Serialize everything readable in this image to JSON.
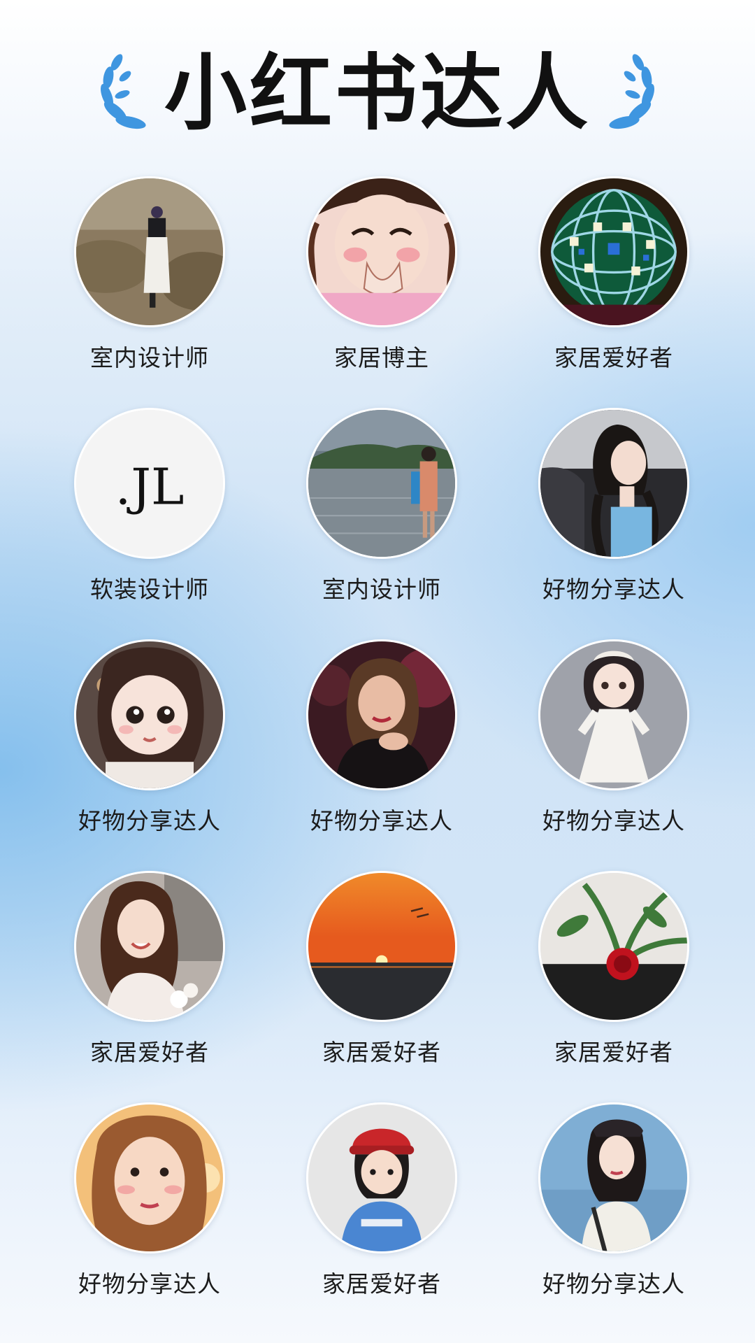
{
  "page": {
    "title": "小红书达人"
  },
  "influencers": [
    {
      "label": "室内设计师",
      "avatar": "avatar-hiker-back-icon"
    },
    {
      "label": "家居博主",
      "avatar": "avatar-anime-girl-icon"
    },
    {
      "label": "家居爱好者",
      "avatar": "avatar-colorful-sphere-icon"
    },
    {
      "label": "软装设计师",
      "avatar": "avatar-jl-logo-icon",
      "logo_text": ".JL"
    },
    {
      "label": "室内设计师",
      "avatar": "avatar-lake-girl-icon"
    },
    {
      "label": "好物分享达人",
      "avatar": "avatar-girl-car-icon"
    },
    {
      "label": "好物分享达人",
      "avatar": "avatar-doll-girl-icon"
    },
    {
      "label": "好物分享达人",
      "avatar": "avatar-woman-red-light-icon"
    },
    {
      "label": "好物分享达人",
      "avatar": "avatar-3d-girl-dress-icon"
    },
    {
      "label": "家居爱好者",
      "avatar": "avatar-smiling-woman-icon"
    },
    {
      "label": "家居爱好者",
      "avatar": "avatar-sunset-sea-icon"
    },
    {
      "label": "家居爱好者",
      "avatar": "avatar-red-rose-icon"
    },
    {
      "label": "好物分享达人",
      "avatar": "avatar-selfie-woman-icon"
    },
    {
      "label": "家居爱好者",
      "avatar": "avatar-cartoon-boy-red-hat-icon"
    },
    {
      "label": "好物分享达人",
      "avatar": "avatar-woman-beach-icon"
    }
  ],
  "colors": {
    "laurel": "#3f96e0",
    "title": "#111111",
    "label": "#1b1b1b"
  }
}
